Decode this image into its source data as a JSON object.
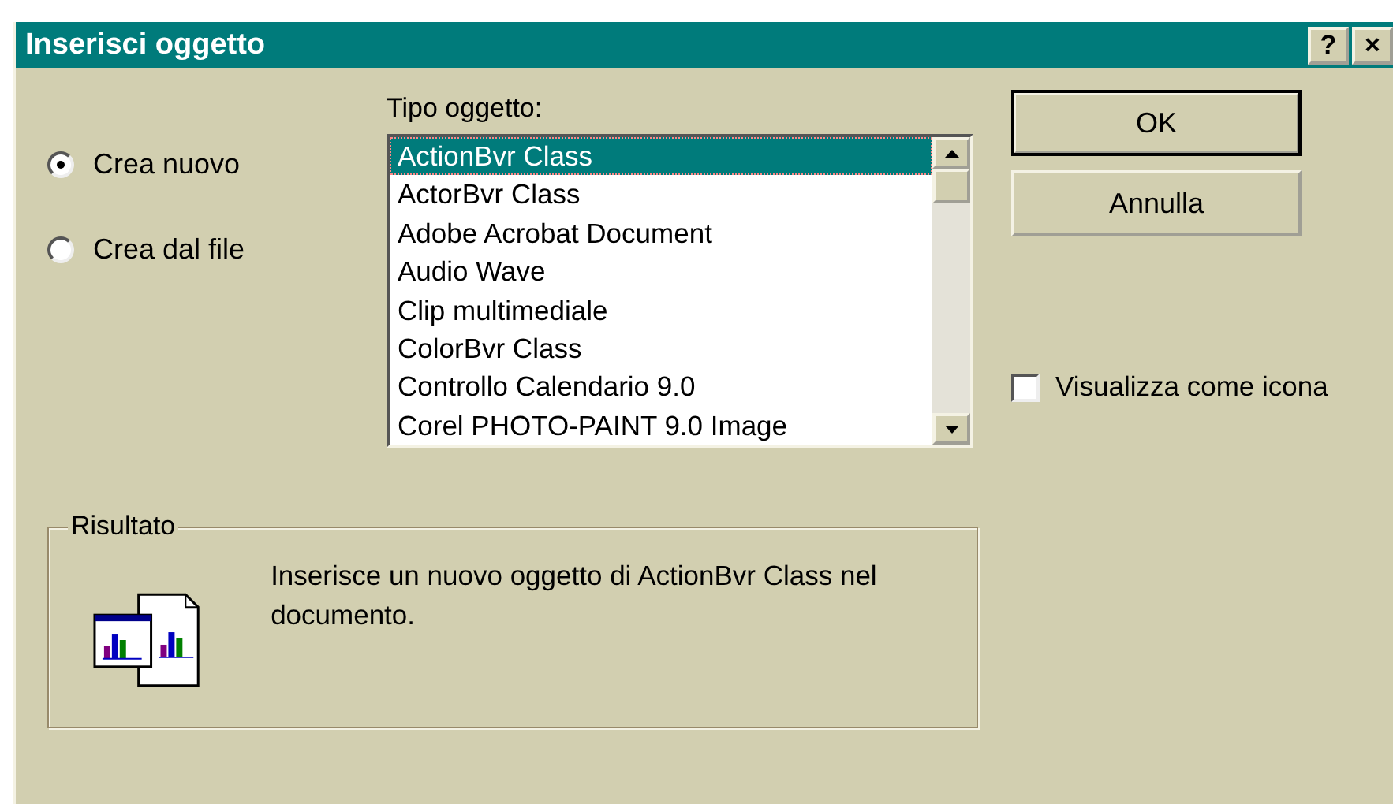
{
  "window": {
    "title": "Inserisci oggetto",
    "title_buttons": [
      "?",
      "×"
    ]
  },
  "options": [
    {
      "label": "Crea nuovo",
      "selected": true
    },
    {
      "label": "Crea dal file",
      "selected": false
    }
  ],
  "object_type": {
    "label": "Tipo oggetto:",
    "items": [
      {
        "label": "ActionBvr Class",
        "selected": true
      },
      {
        "label": "ActorBvr Class",
        "selected": false
      },
      {
        "label": "Adobe Acrobat Document",
        "selected": false
      },
      {
        "label": "Audio Wave",
        "selected": false
      },
      {
        "label": "Clip multimediale",
        "selected": false
      },
      {
        "label": "ColorBvr Class",
        "selected": false
      },
      {
        "label": "Controllo Calendario 9.0",
        "selected": false
      },
      {
        "label": "Corel PHOTO-PAINT 9.0 Image",
        "selected": false
      }
    ]
  },
  "buttons": [
    {
      "label": "OK",
      "default": true
    },
    {
      "label": "Annulla",
      "default": false
    }
  ],
  "display_as_icon": {
    "label": "Visualizza come icona",
    "checked": false
  },
  "result": {
    "title": "Risultato",
    "text": "Inserisce un nuovo oggetto di ActionBvr Class nel documento."
  }
}
